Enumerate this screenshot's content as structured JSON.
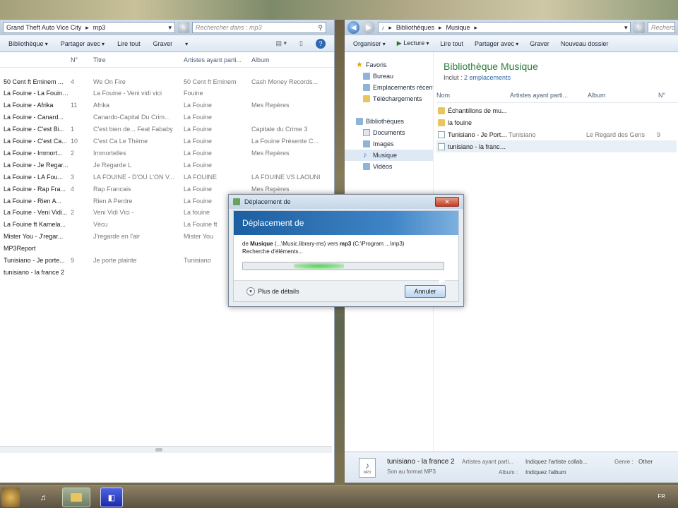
{
  "left_window": {
    "address": [
      "Grand Theft Auto Vice City",
      "mp3"
    ],
    "search_placeholder": "Rechercher dans : mp3",
    "toolbar": [
      "Bibliothèque",
      "Partager avec",
      "Lire tout",
      "Graver"
    ],
    "columns": [
      "N°",
      "Titre",
      "Artistes ayant parti...",
      "Album"
    ],
    "rows": [
      {
        "name": "50 Cent ft Eminem ...",
        "num": "4",
        "title": "We On Fire",
        "artist": "50 Cent ft Eminem",
        "album": "Cash Money Records..."
      },
      {
        "name": "La Fouine - La Fouine ...",
        "num": "",
        "title": "La Fouine - Veni vidi vici",
        "artist": "Fouine",
        "album": ""
      },
      {
        "name": "La Fouine - Afrika",
        "num": "11",
        "title": "Afrika",
        "artist": "La Fouine",
        "album": "Mes Repères"
      },
      {
        "name": "La Fouine - Canard...",
        "num": "",
        "title": "Canardo-Capital Du Crim...",
        "artist": "La Fouine",
        "album": ""
      },
      {
        "name": "La Fouine - C'est Bi...",
        "num": "1",
        "title": "C'est bien de... Feat Fababy",
        "artist": "La Fouine",
        "album": "Capitale du Crime 3"
      },
      {
        "name": "La Fouine - C'est Ca...",
        "num": "10",
        "title": "C'est Ca Le Thème",
        "artist": "La Fouine",
        "album": "La Fouine Présente C..."
      },
      {
        "name": "La Fouine - Immort...",
        "num": "2",
        "title": "Immortelles",
        "artist": "La Fouine",
        "album": "Mes Repères"
      },
      {
        "name": "La Fouine - Je Regar...",
        "num": "",
        "title": "Je Regarde L",
        "artist": "La Fouine",
        "album": ""
      },
      {
        "name": "La Fouine - LA Fou...",
        "num": "3",
        "title": "LA FOUINE - D'OÙ L'ON V...",
        "artist": "LA FOUINE",
        "album": "LA FOUINE VS LAOUNI"
      },
      {
        "name": "La Fouine - Rap Fra...",
        "num": "4",
        "title": "Rap Francais",
        "artist": "La Fouine",
        "album": "Mes Repères"
      },
      {
        "name": "La Fouine - Rien A...",
        "num": "",
        "title": "Rien A Perdre",
        "artist": "La Fouine",
        "album": ""
      },
      {
        "name": "La Fouine - Veni Vidi...",
        "num": "2",
        "title": "Veni Vidi Vici -",
        "artist": "La fouine",
        "album": ""
      },
      {
        "name": "La Fouine ft Kamela...",
        "num": "",
        "title": "Vécu",
        "artist": "La Fouine ft",
        "album": ""
      },
      {
        "name": "Mister You - J'regar...",
        "num": "",
        "title": "J'regarde en l'air",
        "artist": "Mister You",
        "album": ""
      },
      {
        "name": "MP3Report",
        "num": "",
        "title": "",
        "artist": "",
        "album": ""
      },
      {
        "name": "Tunisiano - Je porte...",
        "num": "9",
        "title": "Je porte plainte",
        "artist": "Tunisiano",
        "album": ""
      },
      {
        "name": "tunisiano - la france 2",
        "num": "",
        "title": "",
        "artist": "",
        "album": ""
      }
    ]
  },
  "right_window": {
    "address": [
      "Bibliothèques",
      "Musique"
    ],
    "search_placeholder": "Recherche",
    "toolbar": [
      "Organiser",
      "Lecture",
      "Lire tout",
      "Partager avec",
      "Graver",
      "Nouveau dossier"
    ],
    "nav": {
      "favorites": "Favoris",
      "favorites_items": [
        "Bureau",
        "Emplacements récents",
        "Téléchargements"
      ],
      "libraries": "Bibliothèques",
      "libraries_items": [
        "Documents",
        "Images",
        "Musique",
        "Vidéos"
      ]
    },
    "library_title": "Bibliothèque Musique",
    "library_sub_prefix": "Inclut :",
    "library_sub_link": "2 emplacements",
    "columns": [
      "Nom",
      "Artistes ayant parti...",
      "Album",
      "N°"
    ],
    "rows": [
      {
        "name": "Échantillons de mu...",
        "artist": "",
        "album": "",
        "num": "",
        "kind": "folder"
      },
      {
        "name": "la fouine",
        "artist": "",
        "album": "",
        "num": "",
        "kind": "folder"
      },
      {
        "name": "Tunisiano - Je Porte...",
        "artist": "Tunisiano",
        "album": "Le Regard des Gens",
        "num": "9",
        "kind": "file"
      },
      {
        "name": "tunisiano - la france 2",
        "artist": "",
        "album": "",
        "num": "",
        "kind": "file"
      }
    ],
    "details": {
      "filename": "tunisiano - la france 2",
      "format": "Son au format MP3",
      "artist_label": "Artistes ayant parti...",
      "artist_value": "Indiquez l'artiste collab...",
      "album_label": "Album :",
      "album_value": "Indiquez l'album",
      "genre_label": "Genre :",
      "genre_value": "Other",
      "icon_text": "MP3"
    }
  },
  "dialog": {
    "title": "Déplacement de",
    "banner": "Déplacement de",
    "line1_prefix": "de",
    "line1_src": "Musique",
    "line1_mid": "(...\\Music.library-ms)  vers",
    "line1_dst": "mp3",
    "line1_suffix": "(C:\\Program ...\\mp3)",
    "line2": "Recherche d'éléments...",
    "more": "Plus de détails",
    "cancel": "Annuler",
    "progress": 0.3
  },
  "taskbar": {
    "language": "FR"
  }
}
